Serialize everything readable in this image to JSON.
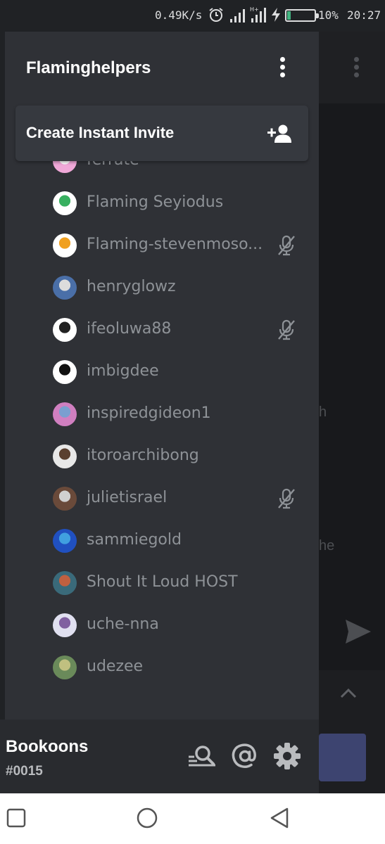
{
  "status_bar": {
    "net_speed": "0.49K/s",
    "battery_percent": "10%",
    "time": "20:27",
    "icons": [
      "alarm-icon",
      "signal-icon",
      "signal-4g-icon",
      "charging-icon",
      "battery-icon"
    ]
  },
  "server": {
    "name": "Flaminghelpers",
    "menu_icon": "kebab-menu-icon"
  },
  "invite": {
    "label": "Create Instant Invite",
    "icon": "add-person-icon"
  },
  "members": [
    {
      "name": "ferrate",
      "muted": false
    },
    {
      "name": "Flaming Seyiodus",
      "muted": false
    },
    {
      "name": "Flaming-stevenmoso...",
      "muted": true
    },
    {
      "name": "henryglowz",
      "muted": false
    },
    {
      "name": "ifeoluwa88",
      "muted": true
    },
    {
      "name": "imbigdee",
      "muted": false
    },
    {
      "name": "inspiredgideon1",
      "muted": false
    },
    {
      "name": "itoroarchibong",
      "muted": false
    },
    {
      "name": "julietisrael",
      "muted": true
    },
    {
      "name": "sammiegold",
      "muted": false
    },
    {
      "name": "Shout It Loud HOST",
      "muted": false
    },
    {
      "name": "uche-nna",
      "muted": false
    },
    {
      "name": "udezee",
      "muted": false
    }
  ],
  "user": {
    "username": "Bookoons",
    "tag": "#0015"
  },
  "background_chat": {
    "fragment_1": "h",
    "fragment_2": "he"
  },
  "colors": {
    "drawer_bg": "#2f3136",
    "member_text": "#8e9297",
    "accent": "#3d4470",
    "battery_fill": "#43b581"
  }
}
